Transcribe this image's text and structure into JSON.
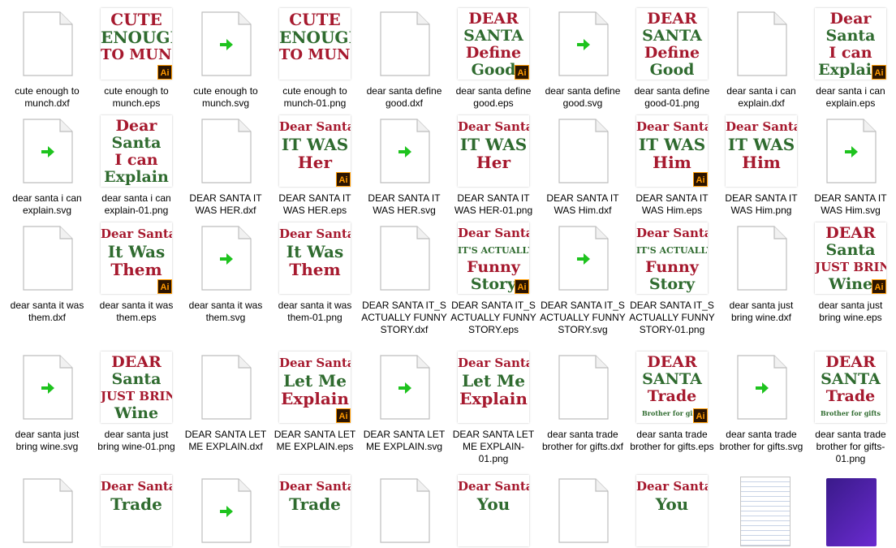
{
  "colors": {
    "red": "#a6192e",
    "green": "#2f6b2f",
    "arrow": "#1ec31e"
  },
  "icons": {
    "document": "blank-document-icon",
    "svg": "svg-document-icon",
    "ai": "adobe-illustrator-badge"
  },
  "files": [
    {
      "name": "cute enough to munch.dxf",
      "kind": "doc"
    },
    {
      "name": "cute enough to munch.eps",
      "kind": "art",
      "ai": true,
      "lines": [
        "CUTE",
        "ENOUGH",
        "TO MUNCH"
      ]
    },
    {
      "name": "cute enough to munch.svg",
      "kind": "svg"
    },
    {
      "name": "cute enough to munch-01.png",
      "kind": "art",
      "ai": false,
      "lines": [
        "CUTE",
        "ENOUGH",
        "TO MUNCH"
      ]
    },
    {
      "name": "dear santa define good.dxf",
      "kind": "doc"
    },
    {
      "name": "dear santa define good.eps",
      "kind": "art",
      "ai": true,
      "lines": [
        "DEAR",
        "SANTA",
        "Define",
        "Good"
      ]
    },
    {
      "name": "dear santa define good.svg",
      "kind": "svg"
    },
    {
      "name": "dear santa define good-01.png",
      "kind": "art",
      "ai": false,
      "lines": [
        "DEAR",
        "SANTA",
        "Define",
        "Good"
      ]
    },
    {
      "name": "dear santa i can explain.dxf",
      "kind": "doc"
    },
    {
      "name": "dear santa i can explain.eps",
      "kind": "art",
      "ai": true,
      "lines": [
        "Dear",
        "Santa",
        "I can",
        "Explain"
      ]
    },
    {
      "name": "dear santa i can explain.svg",
      "kind": "svg"
    },
    {
      "name": "dear santa i can explain-01.png",
      "kind": "art",
      "ai": false,
      "lines": [
        "Dear",
        "Santa",
        "I can",
        "Explain"
      ]
    },
    {
      "name": "DEAR SANTA IT WAS HER.dxf",
      "kind": "doc"
    },
    {
      "name": "DEAR SANTA IT WAS HER.eps",
      "kind": "art",
      "ai": true,
      "lines": [
        "Dear Santa",
        "IT WAS",
        "Her"
      ]
    },
    {
      "name": "DEAR SANTA IT WAS HER.svg",
      "kind": "svg"
    },
    {
      "name": "DEAR SANTA IT WAS HER-01.png",
      "kind": "art",
      "ai": false,
      "lines": [
        "Dear Santa",
        "IT WAS",
        "Her"
      ]
    },
    {
      "name": "DEAR SANTA IT WAS Him.dxf",
      "kind": "doc"
    },
    {
      "name": "DEAR SANTA IT WAS Him.eps",
      "kind": "art",
      "ai": true,
      "lines": [
        "Dear Santa",
        "IT WAS",
        "Him"
      ]
    },
    {
      "name": "DEAR SANTA IT WAS Him.png",
      "kind": "art",
      "ai": false,
      "lines": [
        "Dear Santa",
        "IT WAS",
        "Him"
      ]
    },
    {
      "name": "DEAR SANTA IT WAS Him.svg",
      "kind": "svg"
    },
    {
      "name": "dear santa it was them.dxf",
      "kind": "doc"
    },
    {
      "name": "dear santa it was them.eps",
      "kind": "art",
      "ai": true,
      "lines": [
        "Dear Santa",
        "It Was",
        "Them"
      ]
    },
    {
      "name": "dear santa it was them.svg",
      "kind": "svg"
    },
    {
      "name": "dear santa it was them-01.png",
      "kind": "art",
      "ai": false,
      "lines": [
        "Dear Santa",
        "It Was",
        "Them"
      ]
    },
    {
      "name": "DEAR SANTA IT_S ACTUALLY FUNNY STORY.dxf",
      "kind": "doc"
    },
    {
      "name": "DEAR SANTA IT_S ACTUALLY FUNNY STORY.eps",
      "kind": "art",
      "ai": true,
      "lines": [
        "Dear Santa",
        "IT'S ACTUALLY",
        "Funny",
        "Story"
      ]
    },
    {
      "name": "DEAR SANTA IT_S ACTUALLY FUNNY STORY.svg",
      "kind": "svg"
    },
    {
      "name": "DEAR SANTA IT_S ACTUALLY FUNNY STORY-01.png",
      "kind": "art",
      "ai": false,
      "lines": [
        "Dear Santa",
        "IT'S ACTUALLY",
        "Funny",
        "Story"
      ]
    },
    {
      "name": "dear santa just bring wine.dxf",
      "kind": "doc"
    },
    {
      "name": "dear santa just bring wine.eps",
      "kind": "art",
      "ai": true,
      "lines": [
        "DEAR",
        "Santa",
        "JUST BRING",
        "Wine"
      ]
    },
    {
      "name": "dear santa just bring wine.svg",
      "kind": "svg"
    },
    {
      "name": "dear santa just bring wine-01.png",
      "kind": "art",
      "ai": false,
      "lines": [
        "DEAR",
        "Santa",
        "JUST BRING",
        "Wine"
      ]
    },
    {
      "name": "DEAR SANTA LET ME  EXPLAIN.dxf",
      "kind": "doc"
    },
    {
      "name": "DEAR SANTA LET ME  EXPLAIN.eps",
      "kind": "art",
      "ai": true,
      "lines": [
        "Dear Santa",
        "Let Me",
        "Explain"
      ]
    },
    {
      "name": "DEAR SANTA LET ME  EXPLAIN.svg",
      "kind": "svg"
    },
    {
      "name": "DEAR SANTA LET ME EXPLAIN-01.png",
      "kind": "art",
      "ai": false,
      "lines": [
        "Dear Santa",
        "Let Me",
        "Explain"
      ]
    },
    {
      "name": "dear santa trade brother for gifts.dxf",
      "kind": "doc"
    },
    {
      "name": "dear santa trade brother for gifts.eps",
      "kind": "art",
      "ai": true,
      "lines": [
        "DEAR",
        "SANTA",
        "Trade",
        "Brother for gifts"
      ]
    },
    {
      "name": "dear santa trade brother for gifts.svg",
      "kind": "svg"
    },
    {
      "name": "dear santa trade brother for gifts-01.png",
      "kind": "art",
      "ai": false,
      "lines": [
        "DEAR",
        "SANTA",
        "Trade",
        "Brother for gifts"
      ]
    },
    {
      "name": "",
      "kind": "doc"
    },
    {
      "name": "",
      "kind": "art",
      "ai": false,
      "lines": [
        "Dear Santa",
        "Trade"
      ]
    },
    {
      "name": "",
      "kind": "svg"
    },
    {
      "name": "",
      "kind": "art",
      "ai": false,
      "lines": [
        "Dear Santa",
        "Trade"
      ]
    },
    {
      "name": "",
      "kind": "doc"
    },
    {
      "name": "",
      "kind": "art",
      "ai": false,
      "lines": [
        "Dear Santa",
        "You"
      ]
    },
    {
      "name": "",
      "kind": "doc"
    },
    {
      "name": "",
      "kind": "art",
      "ai": false,
      "lines": [
        "Dear Santa",
        "You"
      ]
    },
    {
      "name": "",
      "kind": "text"
    },
    {
      "name": "",
      "kind": "media"
    }
  ]
}
